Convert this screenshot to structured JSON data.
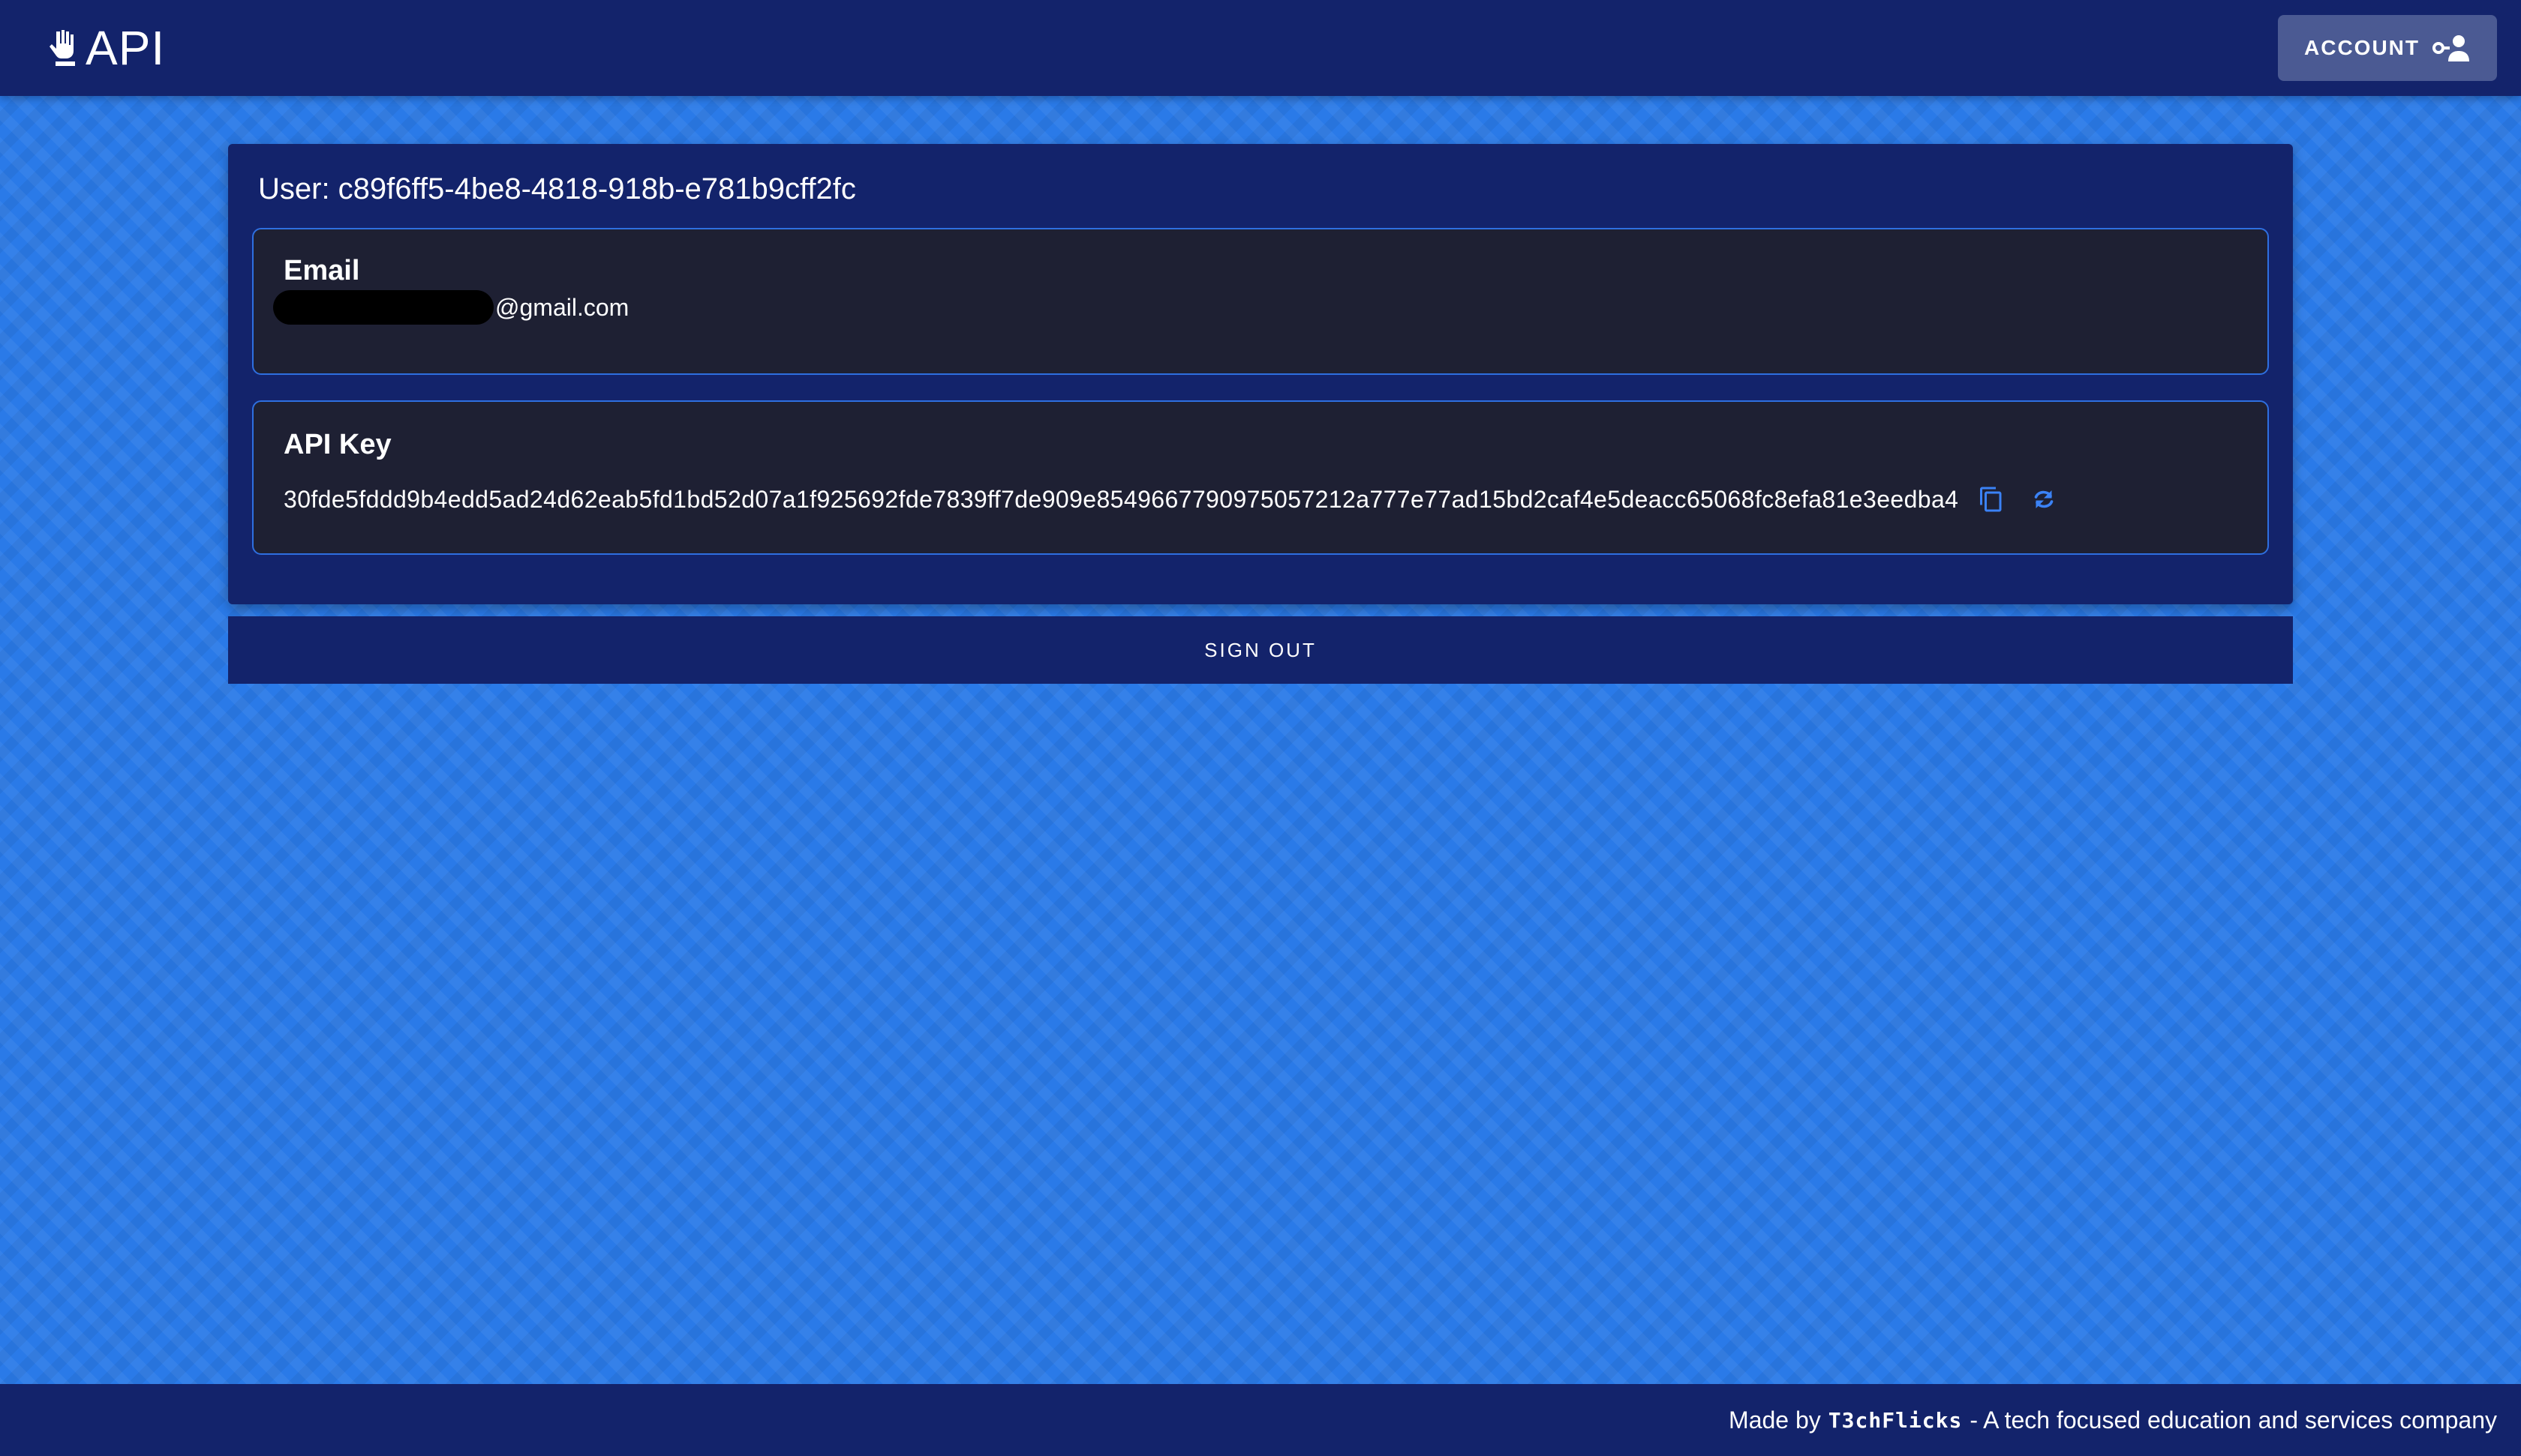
{
  "header": {
    "brand_text": "API",
    "brand_icon": "hand-icon",
    "account_label": "ACCOUNT",
    "account_icon": "account-key-icon"
  },
  "card": {
    "user_title": "User: c89f6ff5-4be8-4818-918b-e781b9cff2fc",
    "email": {
      "label": "Email",
      "value_suffix": "@gmail.com",
      "redacted": true
    },
    "api_key": {
      "label": "API Key",
      "value": "30fde5fddd9b4edd5ad24d62eab5fd1bd52d07a1f925692fde7839ff7de909e8549667790975057212a777e77ad15bd2caf4e5deacc65068fc8efa81e3eedba4",
      "copy_icon": "copy-icon",
      "refresh_icon": "refresh-icon"
    }
  },
  "signout": {
    "label": "SIGN OUT"
  },
  "footer": {
    "prefix": "Made by",
    "brand": "T3chFlicks",
    "suffix": "- A tech focused education and services company"
  },
  "colors": {
    "bar_background": "#13236b",
    "page_background": "#2a7ae8",
    "field_background": "#1e2033",
    "field_border": "#2e6fe0",
    "account_button": "#4b5a93",
    "icon_accent": "#3b82f6"
  }
}
